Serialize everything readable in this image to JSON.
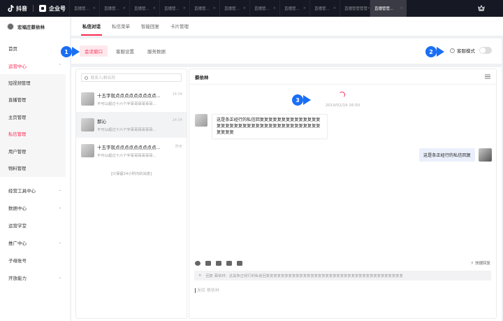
{
  "topbar": {
    "douyin_label": "抖音",
    "enterprise_label": "企业号",
    "tabs": [
      {
        "label": "直播管..."
      },
      {
        "label": "直播管..."
      },
      {
        "label": "直播管..."
      },
      {
        "label": "直播管..."
      },
      {
        "label": "直播管..."
      },
      {
        "label": "直播管..."
      },
      {
        "label": "直播管..."
      },
      {
        "label": "直播管..."
      },
      {
        "label": "直播管..."
      },
      {
        "label": "直播管管管管"
      },
      {
        "label": "直播管管..."
      }
    ],
    "close_glyph": "×"
  },
  "account": {
    "name": "宏福庄蔡依林"
  },
  "sidebar": {
    "home": "首页",
    "ops_center": "运营中心",
    "ops_items": [
      "短视频管理",
      "直播管理",
      "主页管理",
      "私信管理",
      "用户管理",
      "物料管理"
    ],
    "biz_tools": "经营工具中心",
    "data_center": "数据中心",
    "ops_academy": "运营学堂",
    "promo_center": "推广中心",
    "sub_accounts": "子母账号",
    "open_ability": "开放能力"
  },
  "subtabs": [
    "私信对话",
    "私信菜单",
    "智能回复",
    "卡片管理"
  ],
  "innertabs": [
    "会话窗口",
    "客服设置",
    "服务数据"
  ],
  "cs_mode": {
    "label": "客服模式",
    "help_glyph": "?"
  },
  "search": {
    "placeholder": "联系人/群名称"
  },
  "conversations": [
    {
      "name": "十五字就点点点点点点点点点...",
      "preview": "不可以超过十六个字哥哥哥哥哥哥...",
      "time": "14:34"
    },
    {
      "name": "那沁",
      "preview": "不可以超过十六个字哥哥哥哥哥哥...",
      "time": "14:34"
    },
    {
      "name": "十五字就点点点点点点点点点...",
      "preview": "不可以超过十六个字哥哥哥哥哥哥...",
      "time": "昨天"
    }
  ],
  "history_note": "[只保留24小时内的消息]",
  "chat": {
    "contact_name": "蔡依林",
    "timestamp": "2019/02/19 16:50",
    "incoming": "这是条正经行的私信回复复复复复复复复复复复复复复复复复复复复复复复复复复复复复复复复复复复复复复复复复复",
    "outgoing": "这是条正经行的私信回复",
    "quick_reply": "快捷回复",
    "quote_text": "回复 蔡依林：这是条正经行的私信回复复复复复复复复复复复复复复复复复复复复复复复复复复复复复复复复复复复复复",
    "reply_placeholder": "发给 蔡依林",
    "close_glyph": "×"
  },
  "markers": [
    "1",
    "2",
    "3"
  ],
  "colors": {
    "accent": "#fe2c55",
    "marker": "#1a6ef5",
    "topbar": "#161823"
  }
}
